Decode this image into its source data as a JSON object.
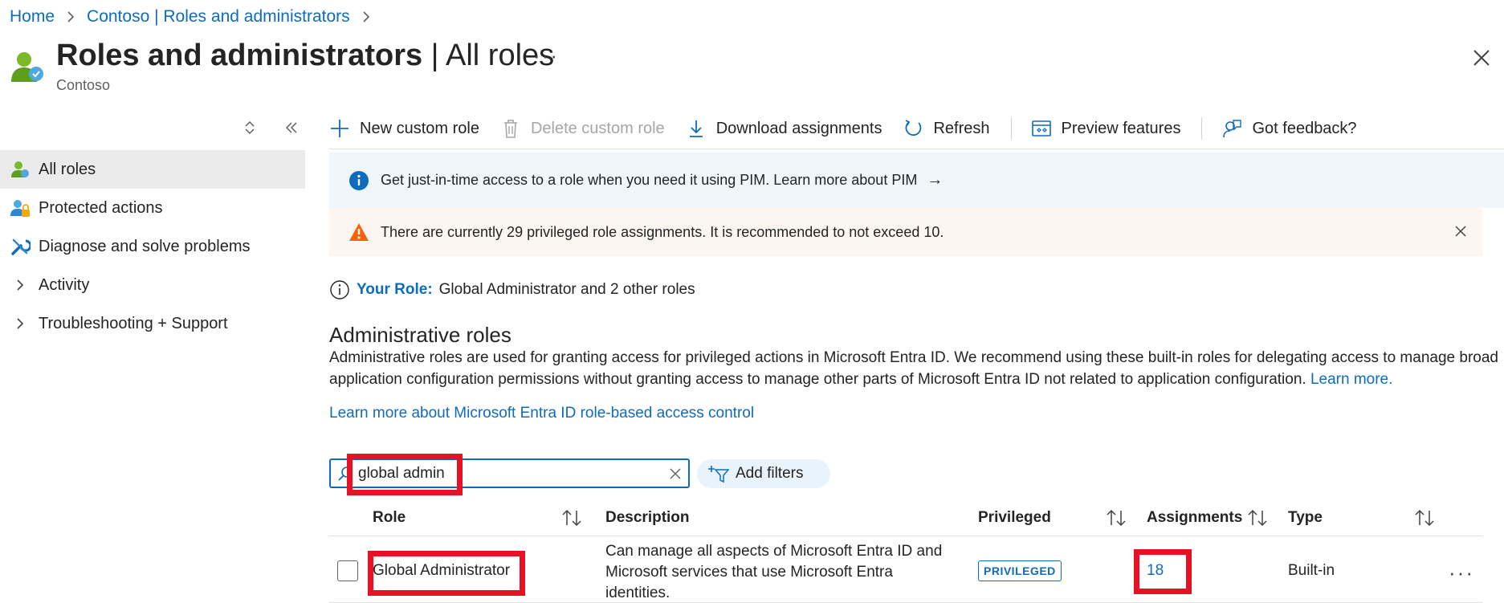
{
  "breadcrumb": {
    "items": [
      "Home",
      "Contoso | Roles and administrators"
    ]
  },
  "header": {
    "title_main": "Roles and administrators",
    "title_sep": " | ",
    "title_sub": "All roles",
    "subtitle": "Contoso",
    "more_label": "···"
  },
  "nav": {
    "items": [
      {
        "label": "All roles",
        "icon": "user-role-icon",
        "active": true
      },
      {
        "label": "Protected actions",
        "icon": "users-lock-icon"
      },
      {
        "label": "Diagnose and solve problems",
        "icon": "wrench-icon"
      },
      {
        "label": "Activity",
        "icon": "chevron-right-icon"
      },
      {
        "label": "Troubleshooting + Support",
        "icon": "chevron-right-icon"
      }
    ]
  },
  "toolbar": {
    "new_custom_role": "New custom role",
    "delete_custom_role": "Delete custom role",
    "download_assignments": "Download assignments",
    "refresh": "Refresh",
    "preview_features": "Preview features",
    "got_feedback": "Got feedback?"
  },
  "info_banner": {
    "text": "Get just-in-time access to a role when you need it using PIM. Learn more about PIM",
    "arrow": "→"
  },
  "warning_banner": {
    "text": "There are currently 29 privileged role assignments. It is recommended to not exceed 10."
  },
  "your_role": {
    "label": "Your Role:",
    "value": "Global Administrator and 2 other roles"
  },
  "section": {
    "title": "Administrative roles",
    "description": "Administrative roles are used for granting access for privileged actions in Microsoft Entra ID. We recommend using these built-in roles for delegating access to manage broad application configuration permissions without granting access to manage other parts of Microsoft Entra ID not related to application configuration.",
    "learn_more": "Learn more.",
    "rbac_link": "Learn more about Microsoft Entra ID role-based access control"
  },
  "search": {
    "value": "global admin"
  },
  "add_filters": "Add filters",
  "table": {
    "columns": {
      "role": "Role",
      "description": "Description",
      "privileged": "Privileged",
      "assignments": "Assignments",
      "type": "Type"
    },
    "rows": [
      {
        "role": "Global Administrator",
        "description": "Can manage all aspects of Microsoft Entra ID and Microsoft services that use Microsoft Entra identities.",
        "privileged": "PRIVILEGED",
        "assignments": "18",
        "type": "Built-in",
        "more": "···"
      }
    ]
  },
  "colors": {
    "accent": "#0f6cbd",
    "info_bg": "#eff6fc",
    "warning_bg": "#fdf6f0",
    "highlight": "#e81123"
  }
}
